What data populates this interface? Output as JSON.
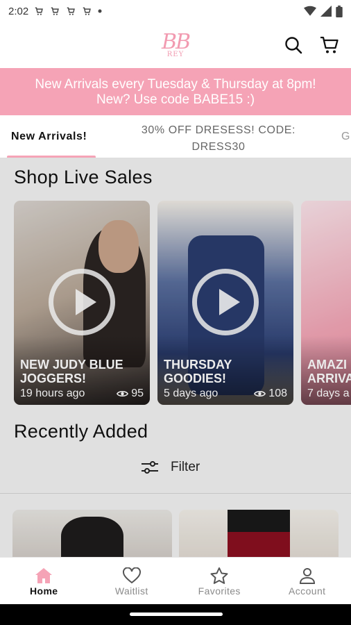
{
  "status_bar": {
    "time": "2:02",
    "notification_icons": [
      "cart-icon",
      "cart-icon",
      "cart-icon",
      "cart-icon",
      "dot-icon"
    ],
    "right_icons": [
      "wifi-icon",
      "signal-icon",
      "battery-icon"
    ]
  },
  "header": {
    "logo_main": "BB",
    "logo_sub": "REY",
    "icons": [
      "search-icon",
      "cart-icon"
    ]
  },
  "promo": {
    "line1": "New Arrivals every Tuesday & Thursday at 8pm!",
    "line2": "New? Use code BABE15 :)"
  },
  "tabs": [
    {
      "label": "New Arrivals!",
      "active": true
    },
    {
      "label": "30% OFF DRESESS! CODE: DRESS30",
      "active": false
    },
    {
      "label": "G",
      "active": false
    }
  ],
  "live_sales": {
    "title": "Shop Live Sales",
    "cards": [
      {
        "title": "NEW JUDY BLUE JOGGERS!",
        "time": "19 hours ago",
        "views": "95"
      },
      {
        "title": "THURSDAY GOODIES!",
        "time": "5 days ago",
        "views": "108"
      },
      {
        "title": "AMAZI ARRIVA",
        "time": "7 days a",
        "views": ""
      }
    ]
  },
  "recently_added": {
    "title": "Recently Added",
    "filter_label": "Filter"
  },
  "bottom_nav": [
    {
      "label": "Home",
      "icon": "home-icon",
      "active": true
    },
    {
      "label": "Waitlist",
      "icon": "heart-icon",
      "active": false
    },
    {
      "label": "Favorites",
      "icon": "star-icon",
      "active": false
    },
    {
      "label": "Account",
      "icon": "account-icon",
      "active": false
    }
  ],
  "colors": {
    "accent_pink": "#f5a3b6",
    "logo_pink": "#f29bb1"
  }
}
